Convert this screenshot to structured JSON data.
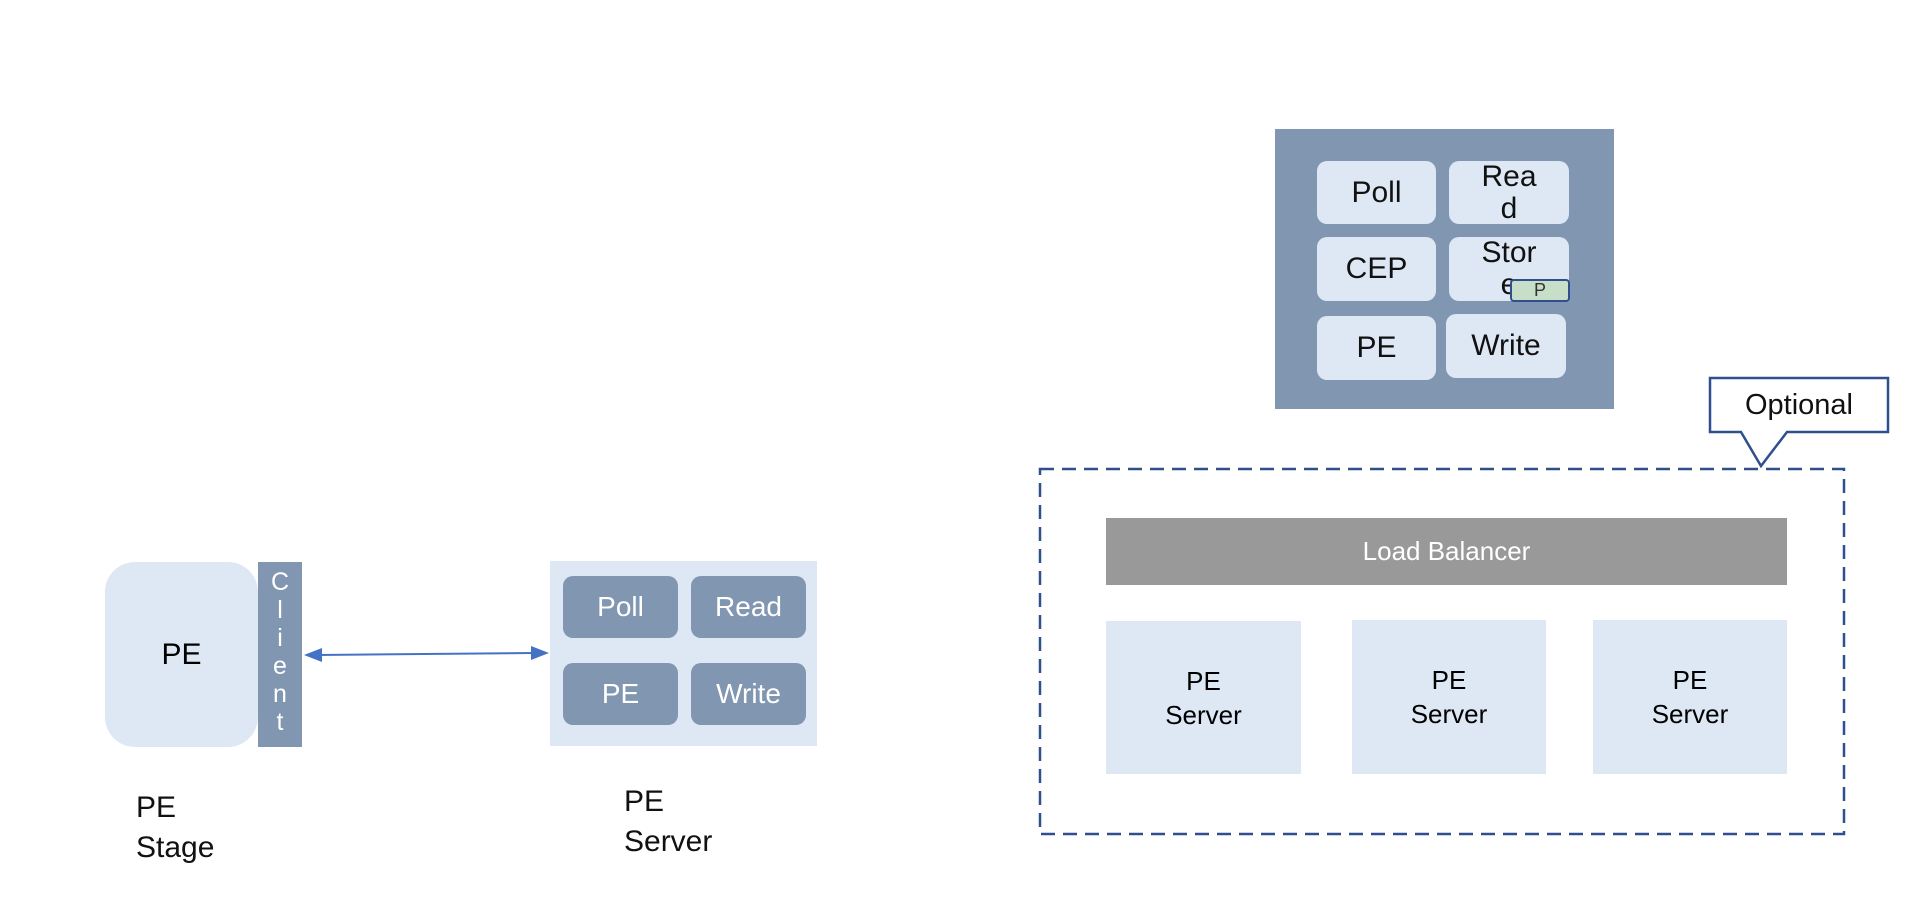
{
  "top_box": {
    "cells": [
      "Poll",
      "Rea d",
      "CEP",
      "Stor e",
      "PE",
      "Write"
    ],
    "badge": "P"
  },
  "callout": "Optional",
  "cluster": {
    "load_balancer": "Load Balancer",
    "servers": [
      "PE Server",
      "PE Server",
      "PE Server"
    ]
  },
  "stage": {
    "pe": "PE",
    "client_letters": [
      "C",
      "l",
      "i",
      "e",
      "n",
      "t"
    ],
    "label": "PE Stage"
  },
  "server": {
    "cells": [
      "Poll",
      "Read",
      "PE",
      "Write"
    ],
    "label": "PE Server"
  },
  "colors": {
    "slate": "#8196b0",
    "light": "#dde8f4",
    "arrow": "#4472c4",
    "dash": "#2f4f8f",
    "lb": "#999999"
  }
}
